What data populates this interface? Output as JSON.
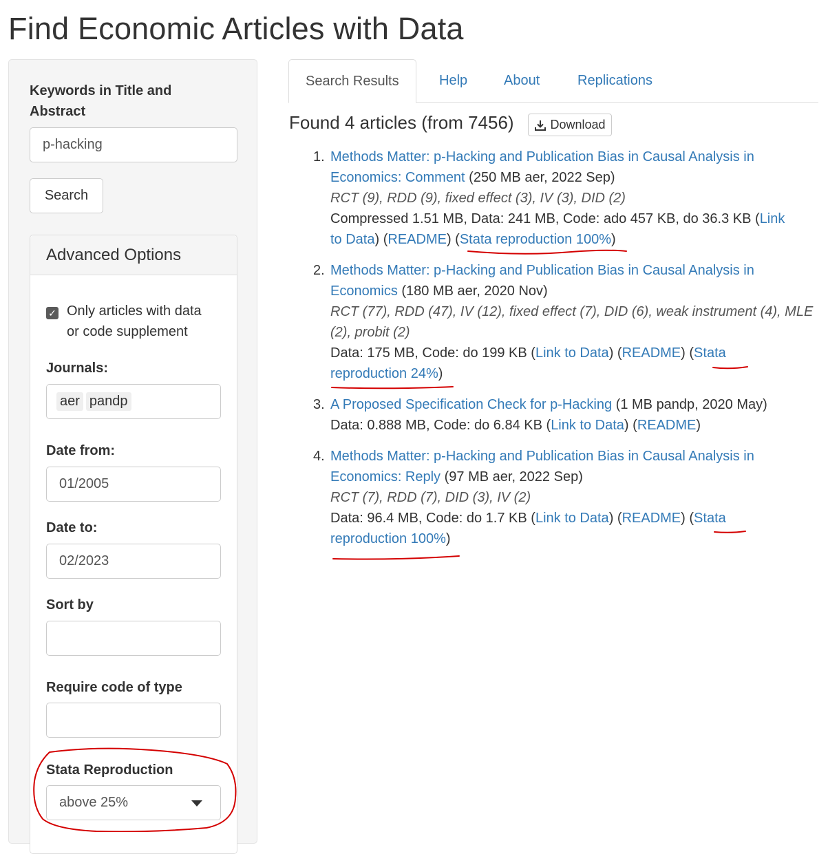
{
  "page": {
    "title": "Find Economic Articles with Data"
  },
  "sidebar": {
    "keywords_label": "Keywords in Title and Abstract",
    "keywords_value": "p-hacking",
    "search_label": "Search",
    "advanced_title": "Advanced Options",
    "only_data_label_line1": "Only articles with data",
    "only_data_label_line2": "or code supplement",
    "only_data_checked": true,
    "journals_label": "Journals:",
    "journals": [
      "aer",
      "pandp"
    ],
    "date_from_label": "Date from:",
    "date_from": "01/2005",
    "date_to_label": "Date to:",
    "date_to": "02/2023",
    "sort_label": "Sort by",
    "sort_value": "",
    "code_type_label": "Require code of type",
    "code_type_value": "",
    "stata_label": "Stata Reproduction",
    "stata_value": "above 25%"
  },
  "tabs": [
    "Search Results",
    "Help",
    "About",
    "Replications"
  ],
  "active_tab": "Search Results",
  "results": {
    "found_text": "Found 4 articles (from 7456)",
    "download_label": "Download",
    "items": [
      {
        "num": "1.",
        "title_l1": "Methods Matter: p-Hacking and Publication Bias in Causal Analysis in",
        "title_l2": "Economics: Comment",
        "meta": " (250 MB aer, 2022 Sep)",
        "methods": "RCT (9), RDD (9), fixed effect (3), IV (3), DID (2)",
        "info1": "Compressed 1.51 MB, Data: 241 MB, Code: ado 457 KB, do 36.3 KB (",
        "link_data_a": "Link",
        "link_data_b": "to Data",
        "readme": "README",
        "stata": "Stata reproduction 100%"
      },
      {
        "num": "2.",
        "title_l1": "Methods Matter: p-Hacking and Publication Bias in Causal Analysis in",
        "title_l2": "Economics",
        "meta": " (180 MB aer, 2020 Nov)",
        "methods_l1": "RCT (77), RDD (47), IV (12), fixed effect (7), DID (6), weak instrument (4), MLE",
        "methods_l2": "(2), probit (2)",
        "info1": "Data: 175 MB, Code: do 199 KB (",
        "link_data": "Link to Data",
        "readme": "README",
        "stata_a": "Stata",
        "stata_b": "reproduction 24%"
      },
      {
        "num": "3.",
        "title": "A Proposed Specification Check for p-Hacking",
        "meta": " (1 MB pandp, 2020 May)",
        "info1": "Data: 0.888 MB, Code: do 6.84 KB (",
        "link_data": "Link to Data",
        "readme": "README"
      },
      {
        "num": "4.",
        "title_l1": "Methods Matter: p-Hacking and Publication Bias in Causal Analysis in",
        "title_l2": "Economics: Reply",
        "meta": " (97 MB aer, 2022 Sep)",
        "methods": "RCT (7), RDD (7), DID (3), IV (2)",
        "info1": "Data: 96.4 MB, Code: do 1.7 KB (",
        "link_data": "Link to Data",
        "readme": "README",
        "stata_a": "Stata",
        "stata_b": "reproduction 100%"
      }
    ]
  },
  "annotation_color": "#d40000"
}
